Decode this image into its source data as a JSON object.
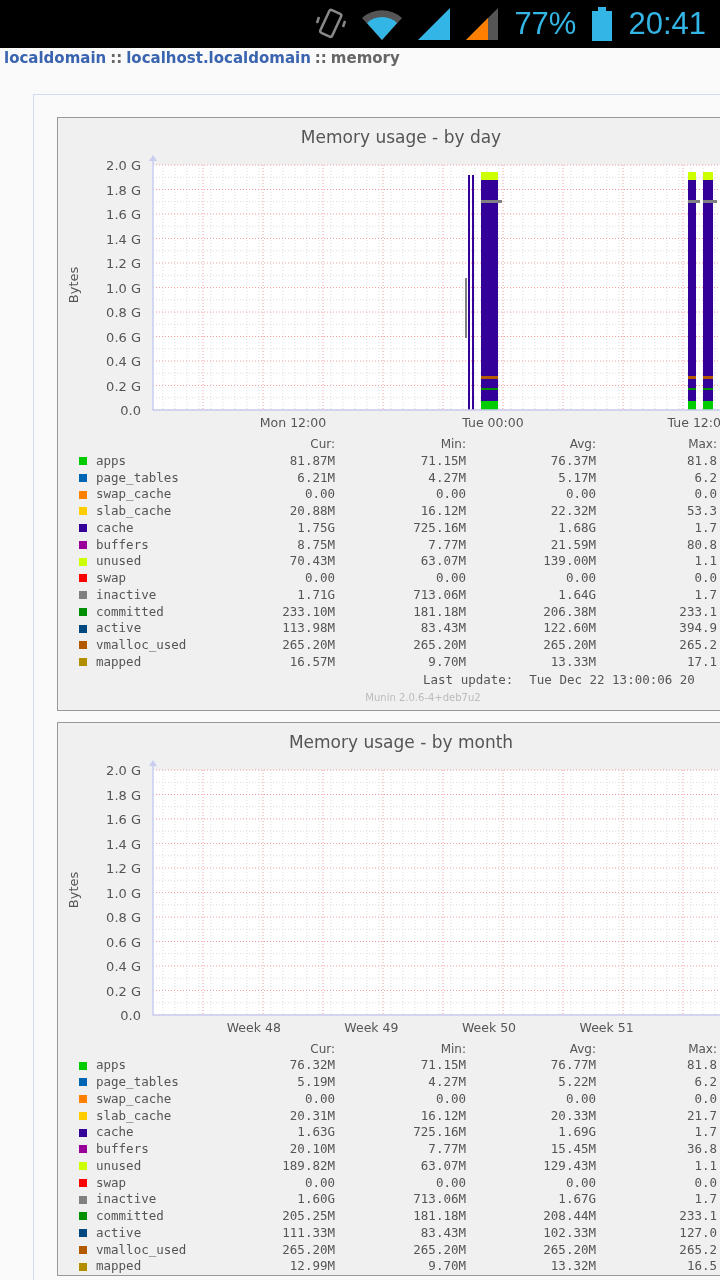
{
  "status_bar": {
    "battery": "77%",
    "time": "20:41"
  },
  "breadcrumb": {
    "separator": "::",
    "items": [
      {
        "label": "localdomain",
        "kind": "link"
      },
      {
        "label": "localhost.localdomain",
        "kind": "link"
      },
      {
        "label": "memory",
        "kind": "current"
      }
    ]
  },
  "graphs": [
    {
      "kind": "day",
      "title": "Memory usage - by day",
      "ylabel": "Bytes",
      "yticks": [
        "2.0 G",
        "1.8 G",
        "1.6 G",
        "1.4 G",
        "1.2 G",
        "1.0 G",
        "0.8 G",
        "0.6 G",
        "0.4 G",
        "0.2 G",
        "0.0"
      ],
      "xticks": [
        "Mon 12:00",
        "Tue 00:00",
        "Tue 12:0"
      ],
      "columns": [
        "Cur:",
        "Min:",
        "Avg:",
        "Max:"
      ],
      "rows": [
        {
          "name": "apps",
          "color": "#00cc00",
          "values": [
            "81.87M",
            "71.15M",
            "76.37M",
            "81.8"
          ]
        },
        {
          "name": "page_tables",
          "color": "#0066b3",
          "values": [
            "6.21M",
            "4.27M",
            "5.17M",
            "6.2"
          ]
        },
        {
          "name": "swap_cache",
          "color": "#ff8000",
          "values": [
            "0.00",
            "0.00",
            "0.00",
            "0.0"
          ]
        },
        {
          "name": "slab_cache",
          "color": "#ffcc00",
          "values": [
            "20.88M",
            "16.12M",
            "22.32M",
            "53.3"
          ]
        },
        {
          "name": "cache",
          "color": "#330099",
          "values": [
            "1.75G",
            "725.16M",
            "1.68G",
            "1.7"
          ]
        },
        {
          "name": "buffers",
          "color": "#990099",
          "values": [
            "8.75M",
            "7.77M",
            "21.59M",
            "80.8"
          ]
        },
        {
          "name": "unused",
          "color": "#ccff00",
          "values": [
            "70.43M",
            "63.07M",
            "139.00M",
            "1.1"
          ]
        },
        {
          "name": "swap",
          "color": "#ff0000",
          "values": [
            "0.00",
            "0.00",
            "0.00",
            "0.0"
          ]
        },
        {
          "name": "inactive",
          "color": "#808080",
          "values": [
            "1.71G",
            "713.06M",
            "1.64G",
            "1.7"
          ]
        },
        {
          "name": "committed",
          "color": "#008f00",
          "values": [
            "233.10M",
            "181.18M",
            "206.38M",
            "233.1"
          ]
        },
        {
          "name": "active",
          "color": "#00487d",
          "values": [
            "113.98M",
            "83.43M",
            "122.60M",
            "394.9"
          ]
        },
        {
          "name": "vmalloc_used",
          "color": "#b35a00",
          "values": [
            "265.20M",
            "265.20M",
            "265.20M",
            "265.2"
          ]
        },
        {
          "name": "mapped",
          "color": "#b38f00",
          "values": [
            "16.57M",
            "9.70M",
            "13.33M",
            "17.1"
          ]
        }
      ],
      "last_update_label": "Last update:",
      "last_update": "Tue Dec 22 13:00:06 20",
      "version": "Munin 2.0.6-4+deb7u2"
    },
    {
      "kind": "month",
      "title": "Memory usage - by month",
      "ylabel": "Bytes",
      "yticks": [
        "2.0 G",
        "1.8 G",
        "1.6 G",
        "1.4 G",
        "1.2 G",
        "1.0 G",
        "0.8 G",
        "0.6 G",
        "0.4 G",
        "0.2 G",
        "0.0"
      ],
      "xticks": [
        "Week 48",
        "Week 49",
        "Week 50",
        "Week 51"
      ],
      "columns": [
        "Cur:",
        "Min:",
        "Avg:",
        "Max:"
      ],
      "rows": [
        {
          "name": "apps",
          "color": "#00cc00",
          "values": [
            "76.32M",
            "71.15M",
            "76.77M",
            "81.8"
          ]
        },
        {
          "name": "page_tables",
          "color": "#0066b3",
          "values": [
            "5.19M",
            "4.27M",
            "5.22M",
            "6.2"
          ]
        },
        {
          "name": "swap_cache",
          "color": "#ff8000",
          "values": [
            "0.00",
            "0.00",
            "0.00",
            "0.0"
          ]
        },
        {
          "name": "slab_cache",
          "color": "#ffcc00",
          "values": [
            "20.31M",
            "16.12M",
            "20.33M",
            "21.7"
          ]
        },
        {
          "name": "cache",
          "color": "#330099",
          "values": [
            "1.63G",
            "725.16M",
            "1.69G",
            "1.7"
          ]
        },
        {
          "name": "buffers",
          "color": "#990099",
          "values": [
            "20.10M",
            "7.77M",
            "15.45M",
            "36.8"
          ]
        },
        {
          "name": "unused",
          "color": "#ccff00",
          "values": [
            "189.82M",
            "63.07M",
            "129.43M",
            "1.1"
          ]
        },
        {
          "name": "swap",
          "color": "#ff0000",
          "values": [
            "0.00",
            "0.00",
            "0.00",
            "0.0"
          ]
        },
        {
          "name": "inactive",
          "color": "#808080",
          "values": [
            "1.60G",
            "713.06M",
            "1.67G",
            "1.7"
          ]
        },
        {
          "name": "committed",
          "color": "#008f00",
          "values": [
            "205.25M",
            "181.18M",
            "208.44M",
            "233.1"
          ]
        },
        {
          "name": "active",
          "color": "#00487d",
          "values": [
            "111.33M",
            "83.43M",
            "102.33M",
            "127.0"
          ]
        },
        {
          "name": "vmalloc_used",
          "color": "#b35a00",
          "values": [
            "265.20M",
            "265.20M",
            "265.20M",
            "265.2"
          ]
        },
        {
          "name": "mapped",
          "color": "#b38f00",
          "values": [
            "12.99M",
            "9.70M",
            "13.32M",
            "16.5"
          ]
        }
      ]
    }
  ]
}
